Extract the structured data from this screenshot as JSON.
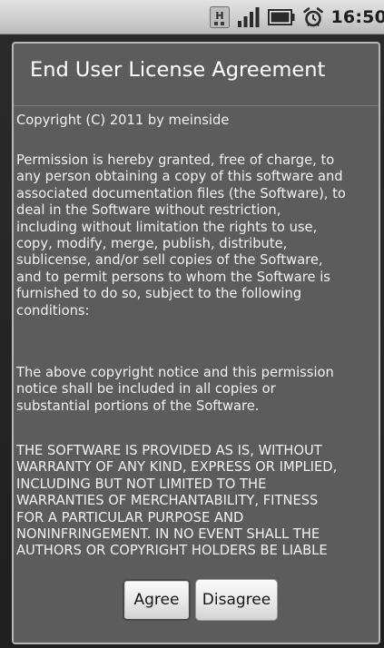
{
  "status_bar": {
    "time": "16:50",
    "icons": [
      "hspa-data-icon",
      "signal-strength-icon",
      "battery-icon",
      "alarm-clock-icon"
    ]
  },
  "dialog": {
    "title": "End User License Agreement",
    "body": {
      "copyright": "Copyright (C) 2011 by meinside",
      "permission_lines": [
        "Permission is hereby granted, free of charge, to",
        "any person obtaining a copy of this software and",
        "associated documentation files (the Software), to",
        "deal in the Software without restriction,",
        "including without limitation the rights to use,",
        "copy, modify, merge, publish, distribute,",
        "sublicense, and/or sell copies of the Software,",
        "and to permit persons to whom the Software is",
        "furnished to do so, subject to the following",
        "conditions:"
      ],
      "notice_lines": [
        " The above copyright notice and this permission",
        "notice shall be included in all copies or",
        "substantial portions of the Software."
      ],
      "warranty_lines": [
        " THE SOFTWARE IS PROVIDED AS IS, WITHOUT",
        "WARRANTY OF ANY KIND, EXPRESS OR IMPLIED,",
        "INCLUDING BUT NOT LIMITED TO THE",
        "WARRANTIES OF MERCHANTABILITY, FITNESS",
        "FOR A PARTICULAR PURPOSE AND",
        "NONINFRINGEMENT. IN NO EVENT SHALL THE",
        "AUTHORS OR COPYRIGHT HOLDERS BE LIABLE"
      ]
    },
    "buttons": {
      "agree_label": "Agree",
      "disagree_label": "Disagree"
    }
  },
  "colors": {
    "status_bar": "#cfcfcf",
    "dialog_background": "#5c5c5c",
    "dialog_border": "#b7b7b7",
    "text": "#f2f2f2",
    "button_background": "#e6e6e6",
    "button_text": "#161616"
  }
}
